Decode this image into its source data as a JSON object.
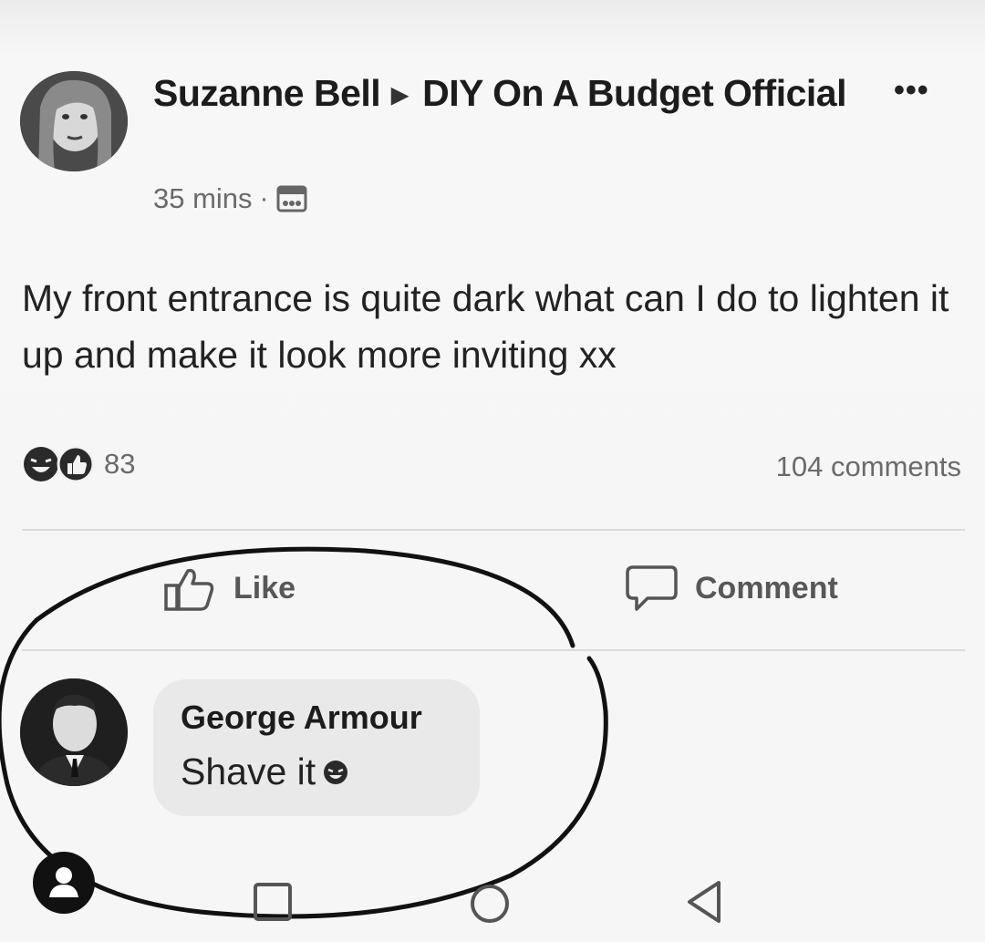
{
  "post": {
    "author": "Suzanne Bell",
    "group": "DIY On A Budget Official",
    "time": "35 mins",
    "text": "My front entrance is quite dark what can I do to lighten it up and make it look more inviting xx",
    "reaction_count": "83",
    "comment_count": "104 comments",
    "more_icon": "more-horizontal-icon",
    "audience_icon": "group-audience-icon"
  },
  "actions": {
    "like_label": "Like",
    "comment_label": "Comment"
  },
  "comment": {
    "author": "George Armour",
    "text": "Shave it"
  },
  "navbar": {
    "icons": [
      "profile-icon",
      "recents-icon",
      "home-icon",
      "back-icon"
    ]
  }
}
